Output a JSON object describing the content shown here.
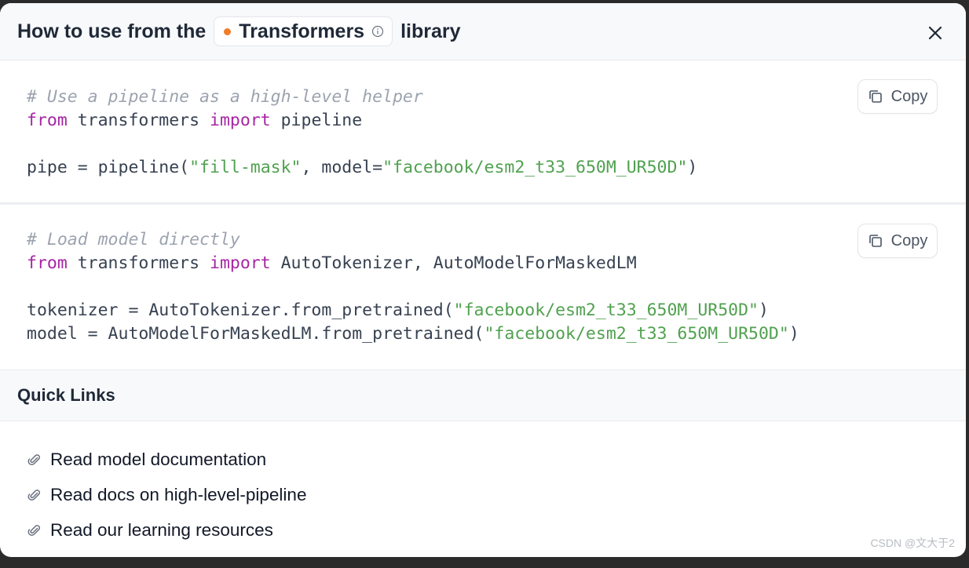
{
  "header": {
    "title_prefix": "How to use from the",
    "library_name": "Transformers",
    "title_suffix": "library",
    "close_icon": "close-icon",
    "info_icon": "info-icon"
  },
  "code_blocks": [
    {
      "copy_label": "Copy",
      "lines": [
        [
          {
            "t": "# Use a pipeline as a high-level helper",
            "c": "cmt"
          }
        ],
        [
          {
            "t": "from",
            "c": "kw"
          },
          {
            "t": " transformers ",
            "c": ""
          },
          {
            "t": "import",
            "c": "kw"
          },
          {
            "t": " pipeline",
            "c": ""
          }
        ],
        [
          {
            "t": "",
            "c": ""
          }
        ],
        [
          {
            "t": "pipe = pipeline(",
            "c": ""
          },
          {
            "t": "\"fill-mask\"",
            "c": "str"
          },
          {
            "t": ", model=",
            "c": ""
          },
          {
            "t": "\"facebook/esm2_t33_650M_UR50D\"",
            "c": "str"
          },
          {
            "t": ")",
            "c": ""
          }
        ]
      ]
    },
    {
      "copy_label": "Copy",
      "lines": [
        [
          {
            "t": "# Load model directly",
            "c": "cmt"
          }
        ],
        [
          {
            "t": "from",
            "c": "kw"
          },
          {
            "t": " transformers ",
            "c": ""
          },
          {
            "t": "import",
            "c": "kw"
          },
          {
            "t": " AutoTokenizer, AutoModelForMaskedLM",
            "c": ""
          }
        ],
        [
          {
            "t": "",
            "c": ""
          }
        ],
        [
          {
            "t": "tokenizer = AutoTokenizer.from_pretrained(",
            "c": ""
          },
          {
            "t": "\"facebook/esm2_t33_650M_UR50D\"",
            "c": "str"
          },
          {
            "t": ")",
            "c": ""
          }
        ],
        [
          {
            "t": "model = AutoModelForMaskedLM.from_pretrained(",
            "c": ""
          },
          {
            "t": "\"facebook/esm2_t33_650M_UR50D\"",
            "c": "str"
          },
          {
            "t": ")",
            "c": ""
          }
        ]
      ]
    }
  ],
  "quick_links": {
    "title": "Quick Links",
    "items": [
      {
        "label": "Read model documentation",
        "icon": "paperclip-icon"
      },
      {
        "label": "Read docs on high-level-pipeline",
        "icon": "paperclip-icon"
      },
      {
        "label": "Read our learning resources",
        "icon": "paperclip-icon"
      }
    ]
  },
  "watermark": "CSDN @文大于2",
  "colors": {
    "accent_dot": "#f07d2a",
    "keyword": "#a626a4",
    "string": "#50a14f",
    "comment": "#9ca3af"
  }
}
